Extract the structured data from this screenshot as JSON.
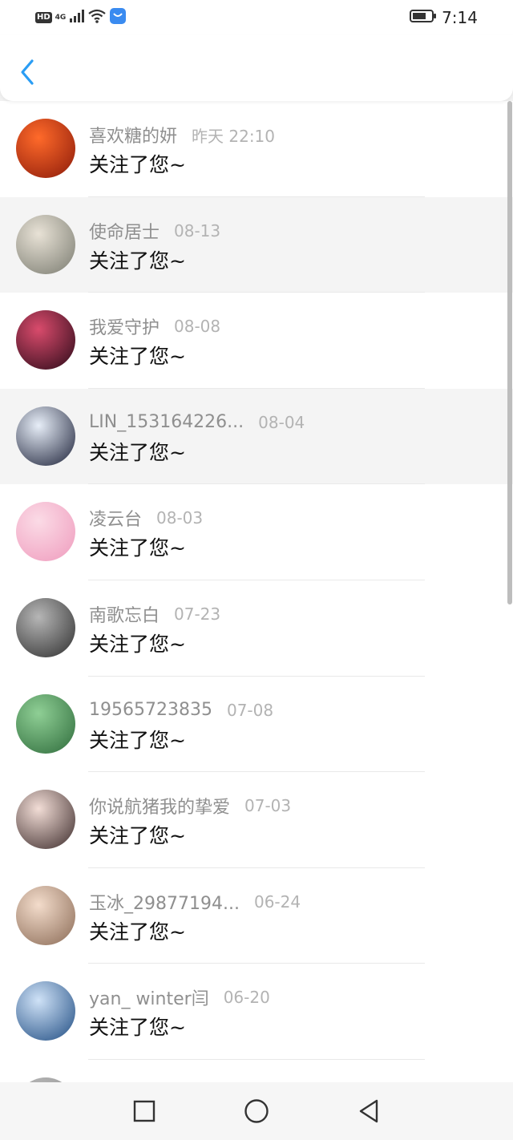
{
  "status_bar": {
    "hd_label": "HD",
    "network_label": "4G",
    "time": "7:14"
  },
  "header": {
    "back_icon": "chevron-left-icon",
    "accent_color": "#2a9df4"
  },
  "message_template": "关注了您~",
  "follows": [
    {
      "name": "喜欢糖的妍",
      "time": "昨天 22:10",
      "message": "关注了您~",
      "avatar_colors": [
        "#ff6a2a",
        "#8b1a0a"
      ]
    },
    {
      "name": "使命居士",
      "time": "08-13",
      "message": "关注了您~",
      "avatar_colors": [
        "#e8e2d6",
        "#7a7b70"
      ]
    },
    {
      "name": "我爱守护",
      "time": "08-08",
      "message": "关注了您~",
      "avatar_colors": [
        "#d94b6c",
        "#2a0a18"
      ]
    },
    {
      "name": "LIN_153164226...",
      "time": "08-04",
      "message": "关注了您~",
      "avatar_colors": [
        "#e7eef8",
        "#1c2138"
      ]
    },
    {
      "name": "凌云台",
      "time": "08-03",
      "message": "关注了您~",
      "avatar_colors": [
        "#fbdbe6",
        "#ef9bbd"
      ]
    },
    {
      "name": "南歌忘白",
      "time": "07-23",
      "message": "关注了您~",
      "avatar_colors": [
        "#b6b6b6",
        "#2e2e2e"
      ]
    },
    {
      "name": "19565723835",
      "time": "07-08",
      "message": "关注了您~",
      "avatar_colors": [
        "#8fcf95",
        "#2e6b3b"
      ]
    },
    {
      "name": "你说航猪我的挚爱",
      "time": "07-03",
      "message": "关注了您~",
      "avatar_colors": [
        "#f2ddd6",
        "#3b2a2a"
      ]
    },
    {
      "name": "玉冰_29877194...",
      "time": "06-24",
      "message": "关注了您~",
      "avatar_colors": [
        "#f3dccb",
        "#8a6a55"
      ]
    },
    {
      "name": "yan_ winter闫",
      "time": "06-20",
      "message": "关注了您~",
      "avatar_colors": [
        "#cfe2f7",
        "#1f4c82"
      ]
    },
    {
      "name": "",
      "time": "",
      "message": "",
      "avatar_colors": [
        "#bdbdbd",
        "#8d8d8d"
      ]
    }
  ],
  "nav_bar": {
    "recent_icon": "square-icon",
    "home_icon": "circle-icon",
    "back_icon": "triangle-back-icon"
  }
}
